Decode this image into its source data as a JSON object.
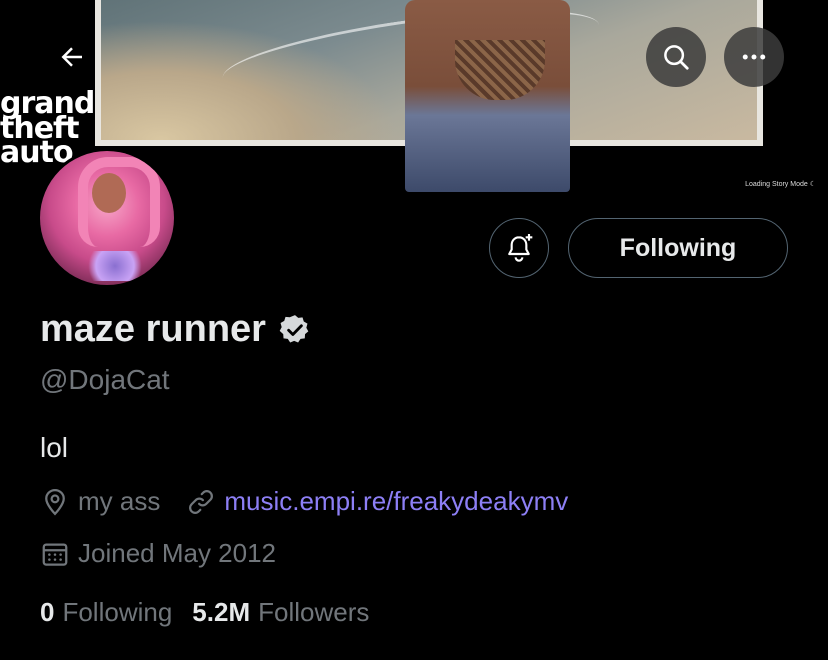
{
  "banner": {
    "gta_logo": "grand theft auto",
    "loading_text": "Loading Story Mode"
  },
  "header": {
    "back_icon": "arrow-left-icon",
    "search_icon": "search-icon",
    "more_icon": "more-horizontal-icon"
  },
  "actions": {
    "notification_icon": "bell-plus-icon",
    "following_label": "Following"
  },
  "profile": {
    "display_name": "maze runner",
    "verified_icon": "verified-badge-icon",
    "handle": "@DojaCat",
    "bio": "lol",
    "location": "my ass",
    "location_icon": "location-pin-icon",
    "website": "music.empi.re/freakydeakymv",
    "website_icon": "link-icon",
    "joined": "Joined May 2012",
    "joined_icon": "calendar-icon"
  },
  "stats": {
    "following_count": "0",
    "following_label": "Following",
    "followers_count": "5.2M",
    "followers_label": "Followers"
  },
  "colors": {
    "background": "#000000",
    "primary_text": "#e7e9ea",
    "secondary_text": "#71767b",
    "link": "#8d7ff5",
    "border": "#536471"
  }
}
